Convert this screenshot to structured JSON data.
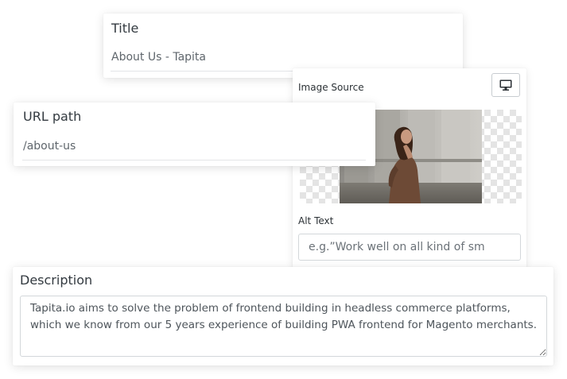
{
  "title_card": {
    "label": "Title",
    "value": "About Us - Tapita"
  },
  "url_card": {
    "label": "URL path",
    "value": "/about-us"
  },
  "image_panel": {
    "source_label": "Image Source",
    "device_toggle_icon": "desktop-monitor-icon",
    "alt_label": "Alt Text",
    "alt_placeholder": "e.g.”Work well on all kind of sm",
    "alt_value": ""
  },
  "description_card": {
    "label": "Description",
    "value": "Tapita.io aims to solve the problem of frontend building in headless commerce platforms, which we know from our 5 years experience of building PWA frontend for Magento merchants."
  },
  "colors": {
    "text_primary": "#333a40",
    "text_secondary": "#5f666c",
    "border": "#d3d7da",
    "checker": "#e4e4e4"
  }
}
